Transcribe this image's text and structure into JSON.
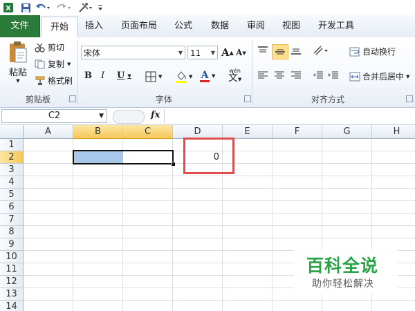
{
  "tabs": [
    "文件",
    "开始",
    "插入",
    "页面布局",
    "公式",
    "数据",
    "审阅",
    "视图",
    "开发工具"
  ],
  "clipboard": {
    "paste": "粘贴",
    "cut": "剪切",
    "copy": "复制",
    "format_painter": "格式刷",
    "group": "剪贴板"
  },
  "font": {
    "name": "宋体",
    "size": "11",
    "group": "字体",
    "pinyin": "wén"
  },
  "alignment": {
    "wrap": "自动换行",
    "merge": "合并后居中",
    "group": "对齐方式"
  },
  "formula_bar": {
    "name_box": "C2",
    "fx": "fx",
    "value": ""
  },
  "grid": {
    "columns": [
      "A",
      "B",
      "C",
      "D",
      "E",
      "F",
      "G",
      "H"
    ],
    "rows": [
      "1",
      "2",
      "3",
      "4",
      "5",
      "6",
      "7",
      "8",
      "9",
      "10",
      "11",
      "12",
      "13",
      "14"
    ],
    "highlighted_columns": [
      "B",
      "C"
    ],
    "highlighted_row": "2",
    "d2_value": "0"
  },
  "watermark": {
    "title": "百科全说",
    "subtitle": "助你轻松解决"
  },
  "colors": {
    "file_tab": "#2b7b3a",
    "selection_fill": "#a9c7e8",
    "header_highlight": "#f5c85c",
    "annotation": "#e04b4b",
    "watermark": "#2aa246"
  }
}
